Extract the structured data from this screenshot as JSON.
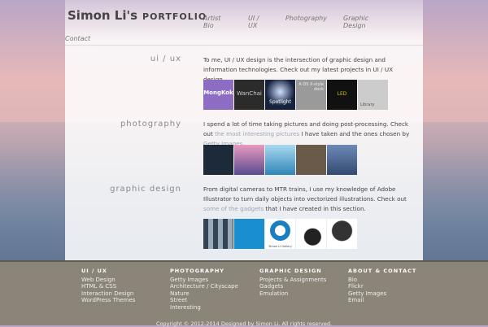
{
  "header": {
    "name": "Simon Li's",
    "portfolio": "PORTFOLIO",
    "nav": [
      {
        "l1": "Artist",
        "l2": "Bio"
      },
      {
        "l1": "UI /",
        "l2": "UX"
      },
      {
        "l1": "Photography",
        "l2": ""
      },
      {
        "l1": "Graphic",
        "l2": "Design"
      },
      {
        "l1": "Contact",
        "l2": ""
      }
    ]
  },
  "sections": [
    {
      "title": "ui / ux",
      "text": "To me, UI / UX design is the intersection of graphic design and information technologies. Check out my latest projects in UI / UX design.",
      "thumbs": [
        "MongKok",
        "WanChai",
        "Spotlight",
        "A OS X-style dock",
        "LED",
        "Library"
      ]
    },
    {
      "title": "photography",
      "pre": "I spend a lot of time taking pictures and doing post-processing. Check out ",
      "link1": "the most interesting pictures",
      "mid": " I have taken and the ones chosen by ",
      "link2": "Getty Images",
      "post": "."
    },
    {
      "title": "graphic design",
      "pre": "From digital cameras to MTR trains, I use my knowledge of Adobe Illustrator to turn daily objects into vectorized illustrations. Check out ",
      "link1": "some of the gadgets",
      "post": " that I have created in this section.",
      "gallery_caption": "Simon Li Gallery"
    }
  ],
  "footer": {
    "cols": [
      {
        "title": "UI / UX",
        "items": [
          "Web Design",
          "HTML & CSS",
          "Interaction Design",
          "WordPress Themes"
        ]
      },
      {
        "title": "PHOTOGRAPHY",
        "items": [
          "Getty Images",
          "Architecture / Cityscape",
          "Nature",
          "Street",
          "Interesting"
        ]
      },
      {
        "title": "GRAPHIC DESIGN",
        "items": [
          "Projects & Assignments",
          "Gadgets",
          "Emulation"
        ]
      },
      {
        "title": "ABOUT & CONTACT",
        "items": [
          "Bio",
          "Flickr",
          "Getty Images",
          "Email"
        ]
      }
    ],
    "copyright": "Copyright © 2012-2014 Designed by Simon Li. All rights reserved."
  }
}
